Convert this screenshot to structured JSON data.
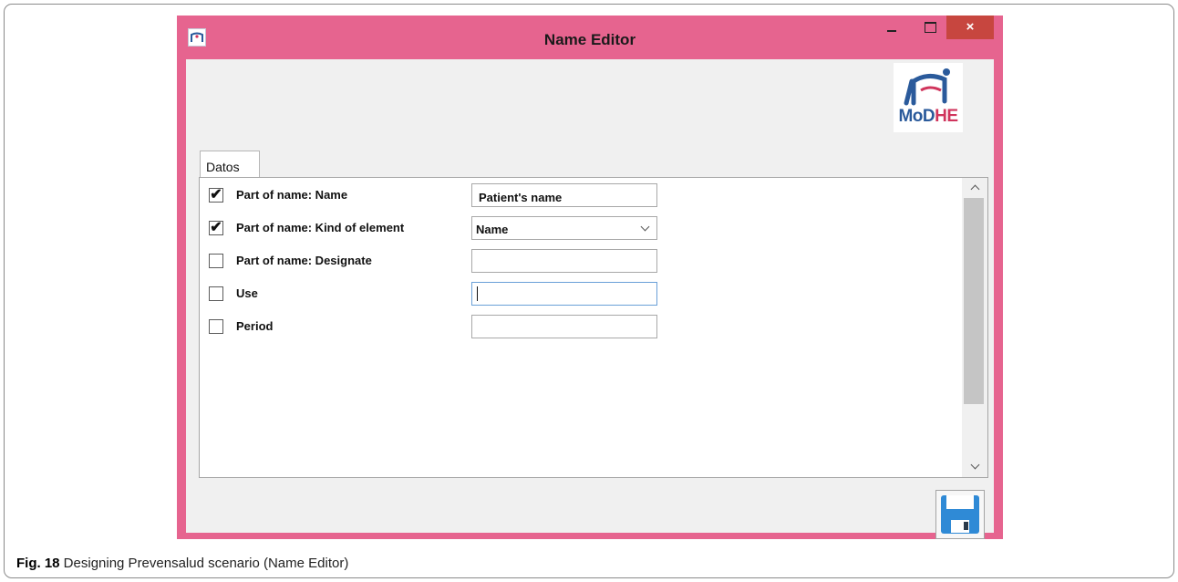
{
  "window": {
    "title": "Name Editor",
    "close_glyph": "×",
    "brand_logo": {
      "text_primary": "MoD",
      "text_accent": "HE"
    }
  },
  "tabs": [
    {
      "label": "Datos"
    }
  ],
  "fields": [
    {
      "label": "Part of name: Name",
      "checked": true,
      "check_glyph": "✔",
      "type": "text",
      "value": "Patient's name"
    },
    {
      "label": "Part of name: Kind of element",
      "checked": true,
      "check_glyph": "✔",
      "type": "select",
      "value": "Name"
    },
    {
      "label": "Part of name: Designate",
      "checked": false,
      "check_glyph": "",
      "type": "text",
      "value": ""
    },
    {
      "label": "Use",
      "checked": false,
      "check_glyph": "",
      "type": "text",
      "value": "",
      "focused": true
    },
    {
      "label": "Period",
      "checked": false,
      "check_glyph": "",
      "type": "text",
      "value": ""
    }
  ],
  "caption": {
    "figure_label": "Fig. 18",
    "text": " Designing Prevensalud scenario (Name Editor)"
  },
  "colors": {
    "titlebar": "#e6648f",
    "close_button": "#c7463f",
    "save_icon": "#2f8ad6",
    "logo_blue": "#2a5a9b",
    "logo_pink": "#d0345c"
  },
  "icons": {
    "app": "modhe-app-icon",
    "save": "floppy-disk-icon",
    "dropdown": "chevron-down-icon"
  }
}
